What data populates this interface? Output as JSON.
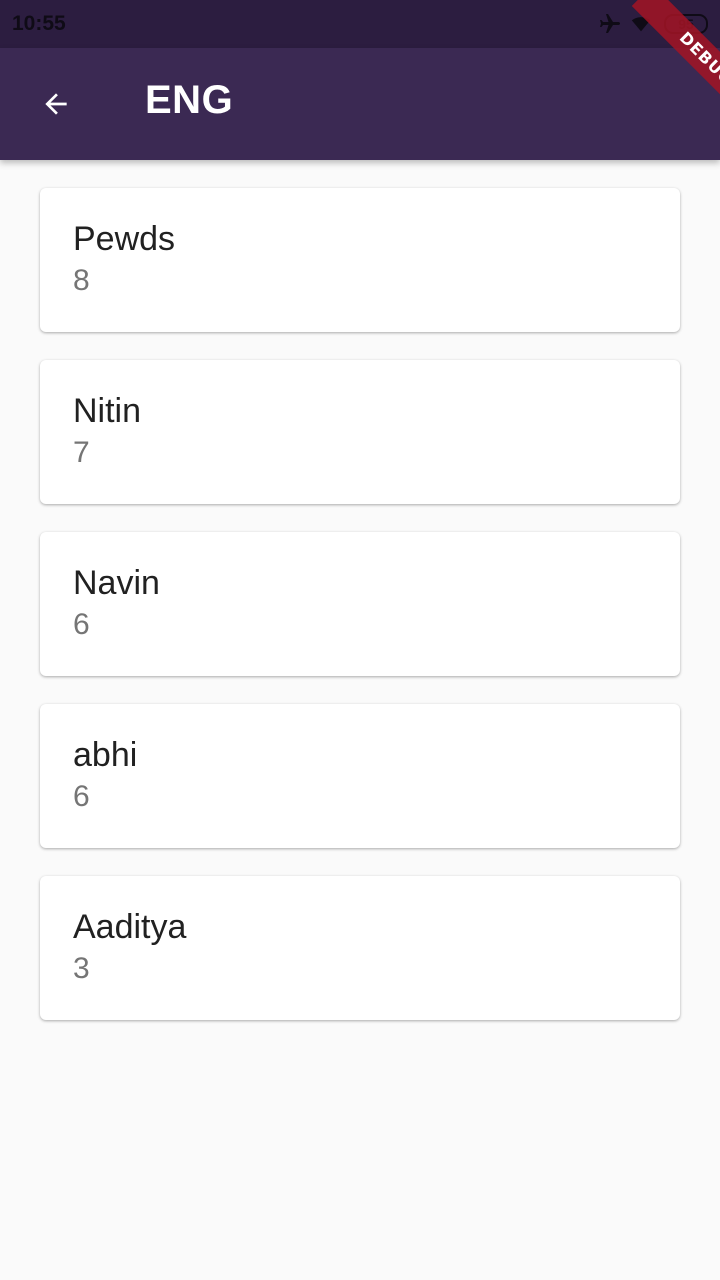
{
  "status_bar": {
    "time": "10:55",
    "battery": "95",
    "icons": [
      "airplane-icon",
      "wifi-icon",
      "battery-icon"
    ]
  },
  "app_bar": {
    "title": "ENG",
    "back_icon": "arrow-back-icon",
    "background": "#3b2953"
  },
  "debug_banner": {
    "label": "DEBUG"
  },
  "cards": [
    {
      "name": "Pewds",
      "score": "8"
    },
    {
      "name": "Nitin",
      "score": "7"
    },
    {
      "name": "Navin",
      "score": "6"
    },
    {
      "name": "abhi",
      "score": "6"
    },
    {
      "name": "Aaditya",
      "score": "3"
    }
  ]
}
